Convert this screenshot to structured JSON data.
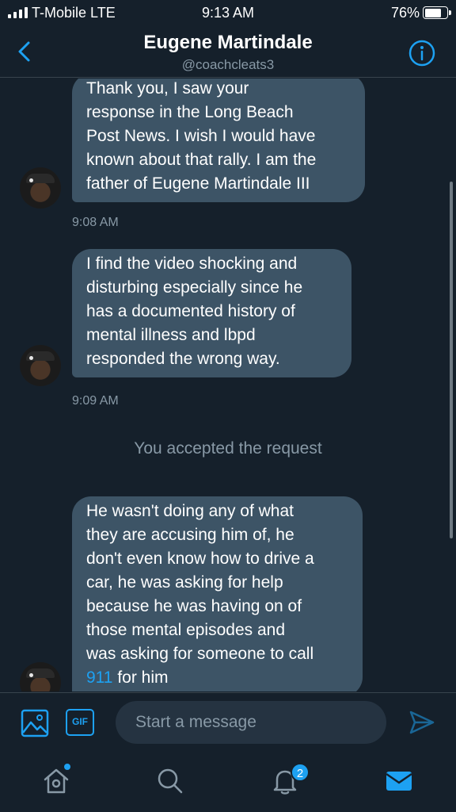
{
  "status_bar": {
    "carrier": "T-Mobile  LTE",
    "time": "9:13 AM",
    "battery": "76%"
  },
  "header": {
    "name": "Eugene Martindale",
    "handle": "@coachcleats3"
  },
  "messages": [
    {
      "text": "Thank you, I saw your\nresponse in the Long Beach\nPost News. I wish I would have\nknown about that rally. I am the\nfather of Eugene Martindale III",
      "time": "9:08 AM"
    },
    {
      "text": "I find the video shocking and\ndisturbing especially since he\nhas a documented history of\nmental illness and lbpd\nresponded the wrong way.",
      "time": "9:09 AM"
    },
    {
      "text_before_link": "He wasn't doing any of what\nthey are accusing him of, he\ndon't even know how to drive a\ncar, he was asking for help\nbecause he was having on of\nthose mental episodes and\nwas asking for someone to call\n",
      "link": "911",
      "text_after_link": " for him"
    }
  ],
  "system_note": "You accepted the request",
  "composer": {
    "placeholder": "Start a message",
    "gif_label": "GIF"
  },
  "tabbar": {
    "notifications_badge": "2"
  },
  "colors": {
    "background": "#15202b",
    "bubble": "#3d5466",
    "accent": "#1da1f2",
    "secondary_text": "#8899a6"
  },
  "icons": [
    "back-icon",
    "info-icon",
    "image-icon",
    "gif-icon",
    "send-icon",
    "home-icon",
    "search-icon",
    "bell-icon",
    "mail-icon"
  ]
}
